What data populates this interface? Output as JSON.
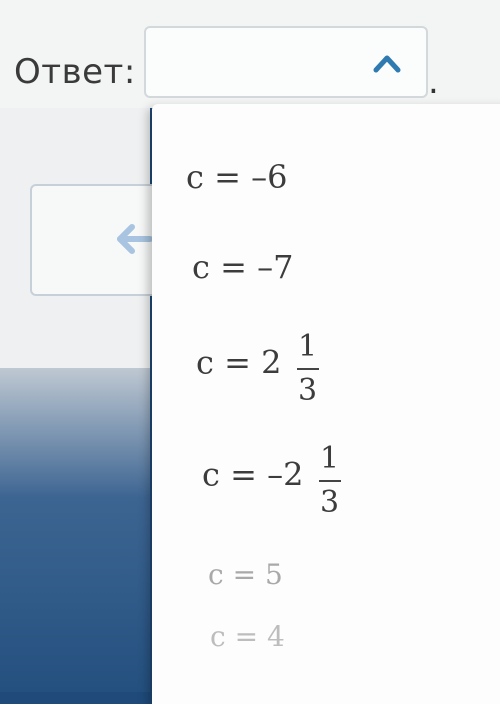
{
  "answer": {
    "label": "Ответ:",
    "selected_value": "",
    "trailing": "."
  },
  "dropdown": {
    "options": [
      {
        "text": "c = –6"
      },
      {
        "text": "c = –7"
      },
      {
        "text": "c = 2",
        "fraction": {
          "numerator": "1",
          "denominator": "3"
        }
      },
      {
        "text": "c = –2",
        "fraction": {
          "numerator": "1",
          "denominator": "3"
        }
      },
      {
        "text": "c = 5"
      },
      {
        "text": "c = 4"
      }
    ]
  },
  "icons": {
    "select": "chevron-up-icon",
    "back": "arrow-left-icon"
  },
  "colors": {
    "accent": "#2f7ab0",
    "back_arrow": "#a8c4e0"
  }
}
